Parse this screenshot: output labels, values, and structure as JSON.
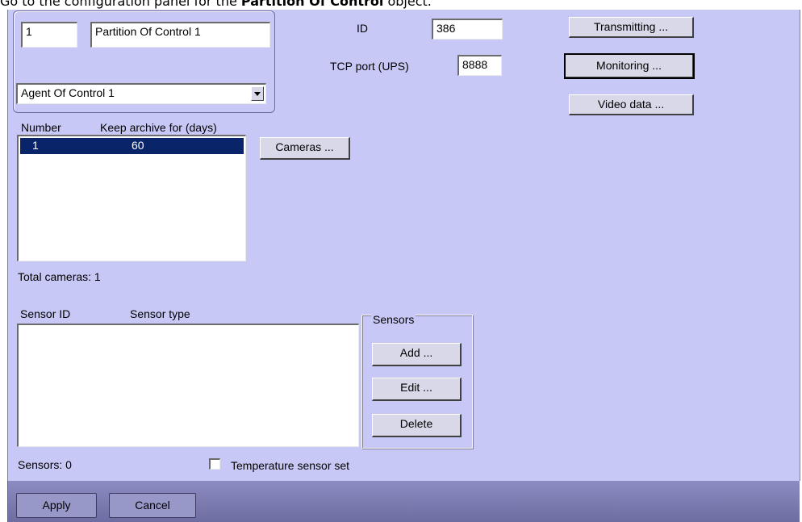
{
  "caption": {
    "prefix": "Go to the configuration panel for the ",
    "bold": "Partition Of Control",
    "suffix": " object."
  },
  "header": {
    "number_value": "1",
    "name_value": "Partition Of Control 1",
    "agent_selected": "Agent Of Control 1",
    "id_label": "ID",
    "id_value": "386",
    "tcp_label": "TCP port (UPS)",
    "tcp_value": "8888"
  },
  "buttons": {
    "transmitting": "Transmitting ...",
    "monitoring": "Monitoring ...",
    "video_data": "Video data ...",
    "cameras": "Cameras ..."
  },
  "cameras_table": {
    "columns": [
      "Number",
      "Keep archive for (days)"
    ],
    "rows": [
      {
        "number": "1",
        "days": "60"
      }
    ],
    "total_label": "Total cameras: 1"
  },
  "sensors_table": {
    "columns": [
      "Sensor ID",
      "Sensor type"
    ],
    "group_label": "Sensors",
    "add": "Add ...",
    "edit": "Edit ...",
    "delete": "Delete",
    "count_label": "Sensors: 0",
    "temperature_label": "Temperature sensor set"
  },
  "footer": {
    "apply": "Apply",
    "cancel": "Cancel"
  },
  "colors": {
    "panel": "#c8c8f6",
    "selection": "#0a246a",
    "footer": "#7a7ab0"
  }
}
